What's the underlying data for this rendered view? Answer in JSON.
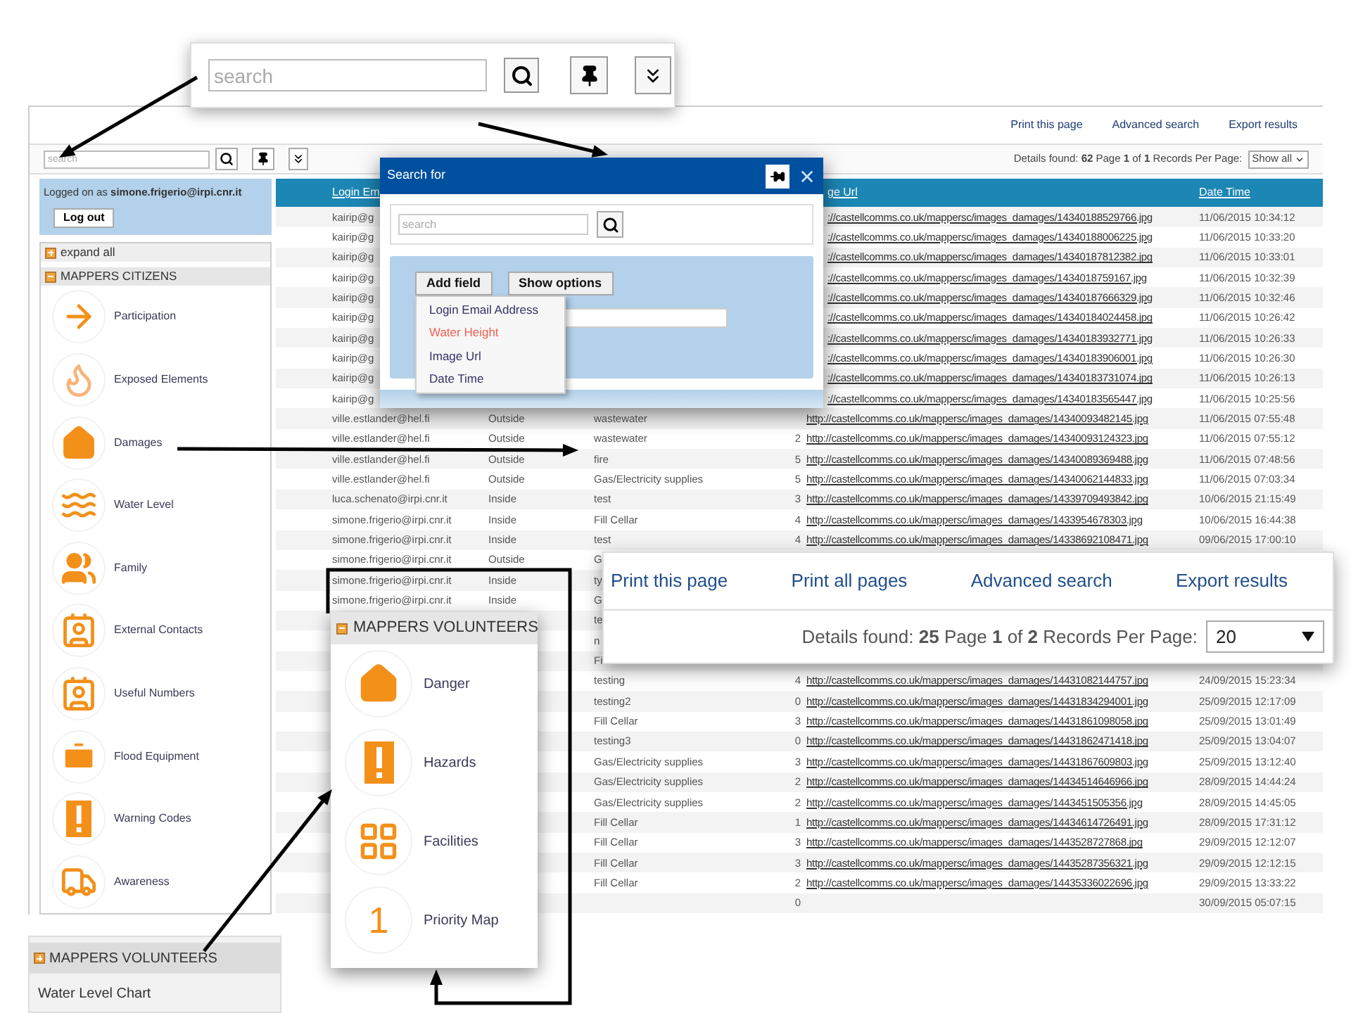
{
  "top_links": [
    "Print this page",
    "Advanced search",
    "Export results"
  ],
  "toolbar": {
    "search_placeholder": "search",
    "details_label": "Details found:",
    "details_count": "62",
    "page_label": "Page",
    "page": "1",
    "of_label": "of",
    "pages": "1",
    "records_label": "Records Per Page:",
    "records_value": "Show all"
  },
  "login": {
    "text": "Logged on as **simone.frigerio@irpi.cnr.it**",
    "logout": "Log out"
  },
  "sidebar": {
    "expand_all": "expand all",
    "section": {
      "title": "MAPPERS CITIZENS",
      "expanded": true,
      "items": [
        {
          "label": "Participation",
          "kind": "arrow"
        },
        {
          "label": "Exposed Elements",
          "kind": "flame"
        },
        {
          "label": "Damages",
          "kind": "house"
        },
        {
          "label": "Water Level",
          "kind": "waves"
        },
        {
          "label": "Family",
          "kind": "people"
        },
        {
          "label": "External Contacts",
          "kind": "contact"
        },
        {
          "label": "Useful Numbers",
          "kind": "contact"
        },
        {
          "label": "Flood Equipment",
          "kind": "toolbox"
        },
        {
          "label": "Warning Codes",
          "kind": "alert"
        },
        {
          "label": "Awareness",
          "kind": "truck"
        }
      ]
    }
  },
  "table": {
    "columns": {
      "email": "Login Em",
      "image_url": "ge Url",
      "date_time": "Date Time"
    },
    "rows": [
      {
        "kind": "covered",
        "email": "kairip@g",
        "image_url": "://castellcomms.co.uk/mappersc/images_damages/14340188529766.jpg",
        "date_time": "11/06/2015 10:34:12"
      },
      {
        "kind": "covered",
        "email": "kairip@g",
        "image_url": "://castellcomms.co.uk/mappersc/images_damages/14340188006225.jpg",
        "date_time": "11/06/2015 10:33:20"
      },
      {
        "kind": "covered",
        "email": "kairip@g",
        "image_url": "://castellcomms.co.uk/mappersc/images_damages/14340187812382.jpg",
        "date_time": "11/06/2015 10:33:01"
      },
      {
        "kind": "covered",
        "email": "kairip@g",
        "image_url": "://castellcomms.co.uk/mappersc/images_damages/1434018759167.jpg",
        "date_time": "11/06/2015 10:32:39"
      },
      {
        "kind": "covered",
        "email": "kairip@g",
        "image_url": "://castellcomms.co.uk/mappersc/images_damages/14340187666329.jpg",
        "date_time": "11/06/2015 10:32:46"
      },
      {
        "kind": "covered",
        "email": "kairip@g",
        "image_url": "://castellcomms.co.uk/mappersc/images_damages/14340184024458.jpg",
        "date_time": "11/06/2015 10:26:42"
      },
      {
        "kind": "covered",
        "email": "kairip@g",
        "image_url": "://castellcomms.co.uk/mappersc/images_damages/14340183932771.jpg",
        "date_time": "11/06/2015 10:26:33"
      },
      {
        "kind": "covered",
        "email": "kairip@g",
        "image_url": "://castellcomms.co.uk/mappersc/images_damages/14340183906001.jpg",
        "date_time": "11/06/2015 10:26:30"
      },
      {
        "kind": "covered",
        "email": "kairip@g",
        "image_url": "://castellcomms.co.uk/mappersc/images_damages/14340183731074.jpg",
        "date_time": "11/06/2015 10:26:13"
      },
      {
        "kind": "covered",
        "email": "kairip@g",
        "image_url": "://castellcomms.co.uk/mappersc/images_damages/14340183565447.jpg",
        "date_time": "11/06/2015 10:25:56"
      },
      {
        "kind": "open",
        "email": "ville.estlander@hel.fi",
        "place": "Outside",
        "description": "wastewater",
        "image_url": "http://castellcomms.co.uk/mappersc/images_damages/14340093482145.jpg",
        "date_time": "11/06/2015 07:55:48"
      },
      {
        "kind": "open",
        "email": "ville.estlander@hel.fi",
        "place": "Outside",
        "description": "wastewater",
        "number": "2",
        "image_url": "http://castellcomms.co.uk/mappersc/images_damages/14340093124323.jpg",
        "date_time": "11/06/2015 07:55:12"
      },
      {
        "kind": "open",
        "email": "ville.estlander@hel.fi",
        "place": "Outside",
        "description": "fire",
        "number": "5",
        "image_url": "http://castellcomms.co.uk/mappersc/images_damages/14340089369488.jpg",
        "date_time": "11/06/2015 07:48:56"
      },
      {
        "kind": "open",
        "email": "ville.estlander@hel.fi",
        "place": "Outside",
        "description": "Gas/Electricity supplies",
        "number": "5",
        "image_url": "http://castellcomms.co.uk/mappersc/images_damages/14340062144833.jpg",
        "date_time": "11/06/2015 07:03:34"
      },
      {
        "kind": "open",
        "email": "luca.schenato@irpi.cnr.it",
        "place": "Inside",
        "description": "test",
        "number": "3",
        "image_url": "http://castellcomms.co.uk/mappersc/images_damages/14339709493842.jpg",
        "date_time": "10/06/2015 21:15:49"
      },
      {
        "kind": "open",
        "email": "simone.frigerio@irpi.cnr.it",
        "place": "Inside",
        "description": "Fill Cellar",
        "number": "4",
        "image_url": "http://castellcomms.co.uk/mappersc/images_damages/1433954678303.jpg",
        "date_time": "10/06/2015 16:44:38"
      },
      {
        "kind": "open",
        "email": "simone.frigerio@irpi.cnr.it",
        "place": "Inside",
        "description": "test",
        "number": "4",
        "image_url": "http://castellcomms.co.uk/mappersc/images_damages/14338692108471.jpg",
        "date_time": "09/06/2015 17:00:10"
      },
      {
        "kind": "open",
        "email": "simone.frigerio@irpi.cnr.it",
        "place": "Outside",
        "description": "G"
      },
      {
        "kind": "open",
        "email": "simone.frigerio@irpi.cnr.it",
        "place": "Inside",
        "description": "ty"
      },
      {
        "kind": "open",
        "email": "simone.frigerio@irpi.cnr.it",
        "place": "Inside",
        "description": "G"
      },
      {
        "kind": "open",
        "description": "te"
      },
      {
        "kind": "open",
        "description": "n"
      },
      {
        "kind": "open",
        "description": "Fi"
      },
      {
        "kind": "open",
        "description": "testing",
        "number": "4",
        "image_url": "http://castellcomms.co.uk/mappersc/images_damages/14431082144757.jpg",
        "date_time": "24/09/2015 15:23:34"
      },
      {
        "kind": "open",
        "description": "testing2",
        "number": "0",
        "image_url": "http://castellcomms.co.uk/mappersc/images_damages/14431834294001.jpg",
        "date_time": "25/09/2015 12:17:09"
      },
      {
        "kind": "open",
        "description": "Fill Cellar",
        "number": "3",
        "image_url": "http://castellcomms.co.uk/mappersc/images_damages/14431861098058.jpg",
        "date_time": "25/09/2015 13:01:49"
      },
      {
        "kind": "open",
        "description": "testing3",
        "number": "0",
        "image_url": "http://castellcomms.co.uk/mappersc/images_damages/14431862471418.jpg",
        "date_time": "25/09/2015 13:04:07"
      },
      {
        "kind": "open",
        "description": "Gas/Electricity supplies",
        "number": "3",
        "image_url": "http://castellcomms.co.uk/mappersc/images_damages/14431867609803.jpg",
        "date_time": "25/09/2015 13:12:40"
      },
      {
        "kind": "open",
        "description": "Gas/Electricity supplies",
        "number": "2",
        "image_url": "http://castellcomms.co.uk/mappersc/images_damages/14434514646966.jpg",
        "date_time": "28/09/2015 14:44:24"
      },
      {
        "kind": "open",
        "description": "Gas/Electricity supplies",
        "number": "2",
        "image_url": "http://castellcomms.co.uk/mappersc/images_damages/1443451505356.jpg",
        "date_time": "28/09/2015 14:45:05"
      },
      {
        "kind": "open",
        "description": "Fill Cellar",
        "number": "1",
        "image_url": "http://castellcomms.co.uk/mappersc/images_damages/14434614726491.jpg",
        "date_time": "28/09/2015 17:31:12"
      },
      {
        "kind": "open",
        "description": "Fill Cellar",
        "number": "3",
        "image_url": "http://castellcomms.co.uk/mappersc/images_damages/1443528727868.jpg",
        "date_time": "29/09/2015 12:12:07"
      },
      {
        "kind": "open",
        "description": "Fill Cellar",
        "number": "3",
        "image_url": "http://castellcomms.co.uk/mappersc/images_damages/14435287356321.jpg",
        "date_time": "29/09/2015 12:12:15"
      },
      {
        "kind": "open",
        "description": "Fill Cellar",
        "number": "2",
        "image_url": "http://castellcomms.co.uk/mappersc/images_damages/14435336022696.jpg",
        "date_time": "29/09/2015 13:33:22"
      },
      {
        "kind": "open",
        "number": "0",
        "date_time": "30/09/2015 05:07:15"
      }
    ]
  },
  "search_dialog": {
    "title": "Search for",
    "search_placeholder": "search",
    "buttons": [
      "Add field",
      "Show options"
    ],
    "field_menu": [
      {
        "label": "Login Email Address",
        "selected": false
      },
      {
        "label": "Water Height",
        "selected": true
      },
      {
        "label": "Image Url",
        "selected": false
      },
      {
        "label": "Date Time",
        "selected": false
      }
    ]
  },
  "search_callout": {
    "search_placeholder": "search"
  },
  "results_callout": {
    "links": [
      "Print this page",
      "Print all pages",
      "Advanced search",
      "Export results"
    ],
    "details_label": "Details found:",
    "details_count": "25",
    "page_label": "Page",
    "page": "1",
    "of_label": "of",
    "pages": "2",
    "records_label": "Records Per Page:",
    "records_value": "20"
  },
  "volunteers_popup": {
    "title": "MAPPERS VOLUNTEERS",
    "expanded": true,
    "items": [
      {
        "label": "Danger",
        "kind": "house"
      },
      {
        "label": "Hazards",
        "kind": "alert"
      },
      {
        "label": "Facilities",
        "kind": "grid"
      },
      {
        "label": "Priority Map",
        "kind": "number",
        "number": "1"
      }
    ]
  },
  "sidebar_callout": {
    "title": "MAPPERS VOLUNTEERS",
    "expanded": false,
    "items": [
      "Water Level Chart"
    ]
  }
}
